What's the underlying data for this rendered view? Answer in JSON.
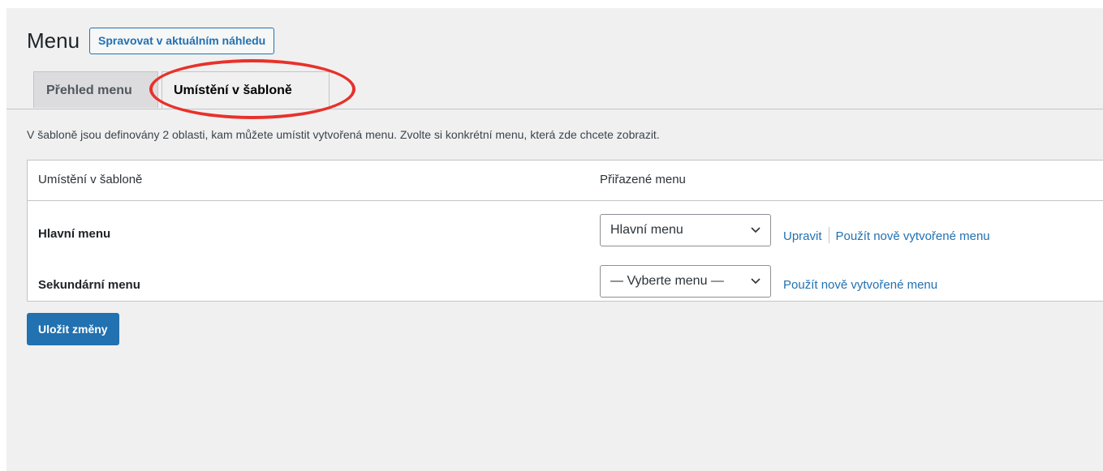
{
  "header": {
    "title": "Menu",
    "manage_live_preview_label": "Spravovat v aktuálním náhledu"
  },
  "tabs": [
    {
      "label": "Přehled menu",
      "active": false
    },
    {
      "label": "Umístění v šabloně",
      "active": true
    }
  ],
  "info_text": "V šabloně jsou definovány 2 oblasti, kam můžete umístit vytvořená menu. Zvolte si konkrétní menu, která zde chcete zobrazit.",
  "table": {
    "columns": [
      "Umístění v šabloně",
      "Přiřazené menu"
    ],
    "rows": [
      {
        "location": "Hlavní menu",
        "selected_menu": "Hlavní menu",
        "edit_link": "Upravit",
        "new_menu_link": "Použít nově vytvořené menu"
      },
      {
        "location": "Sekundární menu",
        "selected_menu": "— Vyberte menu —",
        "new_menu_link": "Použít nově vytvořené menu"
      }
    ]
  },
  "save_button_label": "Uložit změny",
  "colors": {
    "accent": "#2271b1",
    "highlight": "#e8312a",
    "background": "#f0f0f1"
  },
  "icons": {
    "select_chevron": "chevron-down-icon"
  }
}
